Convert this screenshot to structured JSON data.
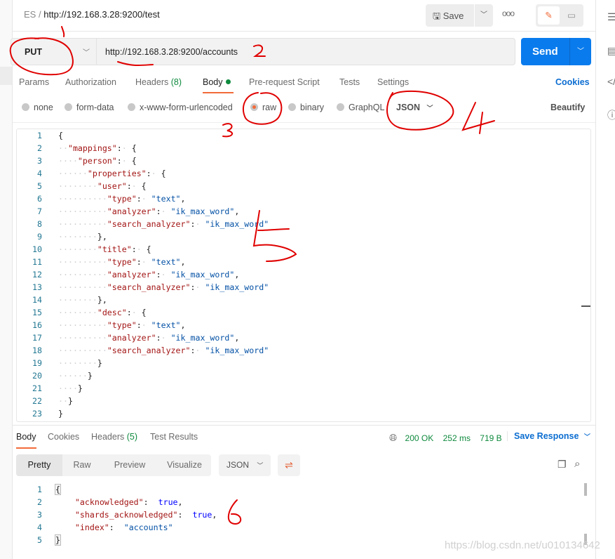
{
  "breadcrumb": {
    "workspace": "ES",
    "separator": "/",
    "request": "http://192.168.3.28:9200/test"
  },
  "toolbar": {
    "save_label": "Save",
    "more_label": "ooo"
  },
  "request": {
    "method": "PUT",
    "url": "http://192.168.3.28:9200/accounts",
    "send_label": "Send"
  },
  "tabs": {
    "params": "Params",
    "authorization": "Authorization",
    "headers": "Headers",
    "headers_count": "(8)",
    "body": "Body",
    "prerequest": "Pre-request Script",
    "tests": "Tests",
    "settings": "Settings",
    "cookies": "Cookies"
  },
  "body_options": {
    "none": "none",
    "form_data": "form-data",
    "urlencoded": "x-www-form-urlencoded",
    "raw": "raw",
    "binary": "binary",
    "graphql": "GraphQL",
    "format": "JSON",
    "beautify": "Beautify",
    "selected": "raw"
  },
  "request_body": [
    "{",
    "  \"mappings\": {",
    "    \"person\": {",
    "      \"properties\": {",
    "        \"user\": {",
    "          \"type\": \"text\",",
    "          \"analyzer\": \"ik_max_word\",",
    "          \"search_analyzer\": \"ik_max_word\"",
    "        },",
    "        \"title\": {",
    "          \"type\": \"text\",",
    "          \"analyzer\": \"ik_max_word\",",
    "          \"search_analyzer\": \"ik_max_word\"",
    "        },",
    "        \"desc\": {",
    "          \"type\": \"text\",",
    "          \"analyzer\": \"ik_max_word\",",
    "          \"search_analyzer\": \"ik_max_word\"",
    "        }",
    "      }",
    "    }",
    "  }",
    "}"
  ],
  "response": {
    "tabs": {
      "body": "Body",
      "cookies": "Cookies",
      "headers": "Headers",
      "headers_count": "(5)",
      "test_results": "Test Results"
    },
    "status": "200 OK",
    "time": "252 ms",
    "size": "719 B",
    "save_response": "Save Response",
    "views": {
      "pretty": "Pretty",
      "raw": "Raw",
      "preview": "Preview",
      "visualize": "Visualize"
    },
    "format": "JSON",
    "body": [
      "{",
      "    \"acknowledged\": true,",
      "    \"shards_acknowledged\": true,",
      "    \"index\": \"accounts\"",
      "}"
    ]
  },
  "watermark": "https://blog.csdn.net/u010134642",
  "colors": {
    "accent": "#f26b3a",
    "send": "#097bed",
    "link": "#0b6dd1",
    "ok": "#0f8a3e",
    "annotation": "#e00000"
  }
}
